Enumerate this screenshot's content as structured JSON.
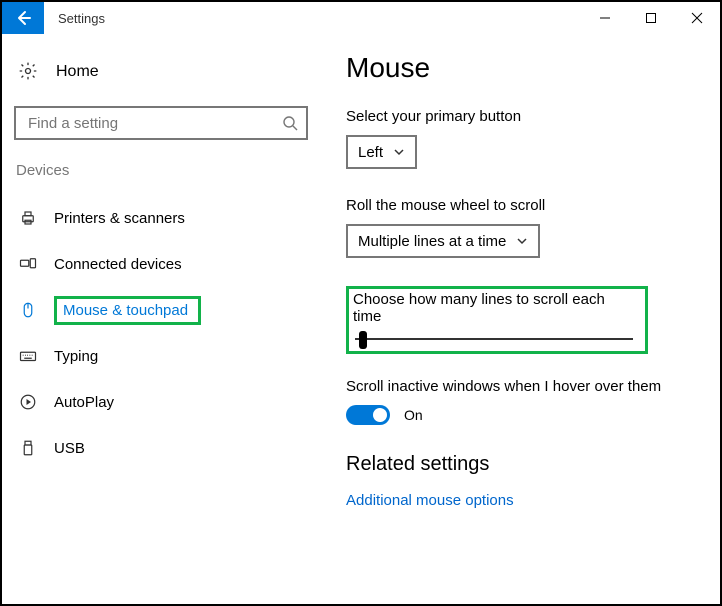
{
  "titlebar": {
    "title": "Settings"
  },
  "sidebar": {
    "home_label": "Home",
    "search_placeholder": "Find a setting",
    "section_label": "Devices",
    "items": [
      {
        "label": "Printers & scanners"
      },
      {
        "label": "Connected devices"
      },
      {
        "label": "Mouse & touchpad"
      },
      {
        "label": "Typing"
      },
      {
        "label": "AutoPlay"
      },
      {
        "label": "USB"
      }
    ]
  },
  "main": {
    "page_title": "Mouse",
    "primary_button": {
      "label": "Select your primary button",
      "value": "Left"
    },
    "wheel_scroll": {
      "label": "Roll the mouse wheel to scroll",
      "value": "Multiple lines at a time"
    },
    "lines_each_time": {
      "label": "Choose how many lines to scroll each time"
    },
    "inactive_scroll": {
      "label": "Scroll inactive windows when I hover over them",
      "state_text": "On"
    },
    "related": {
      "heading": "Related settings",
      "link": "Additional mouse options"
    }
  }
}
